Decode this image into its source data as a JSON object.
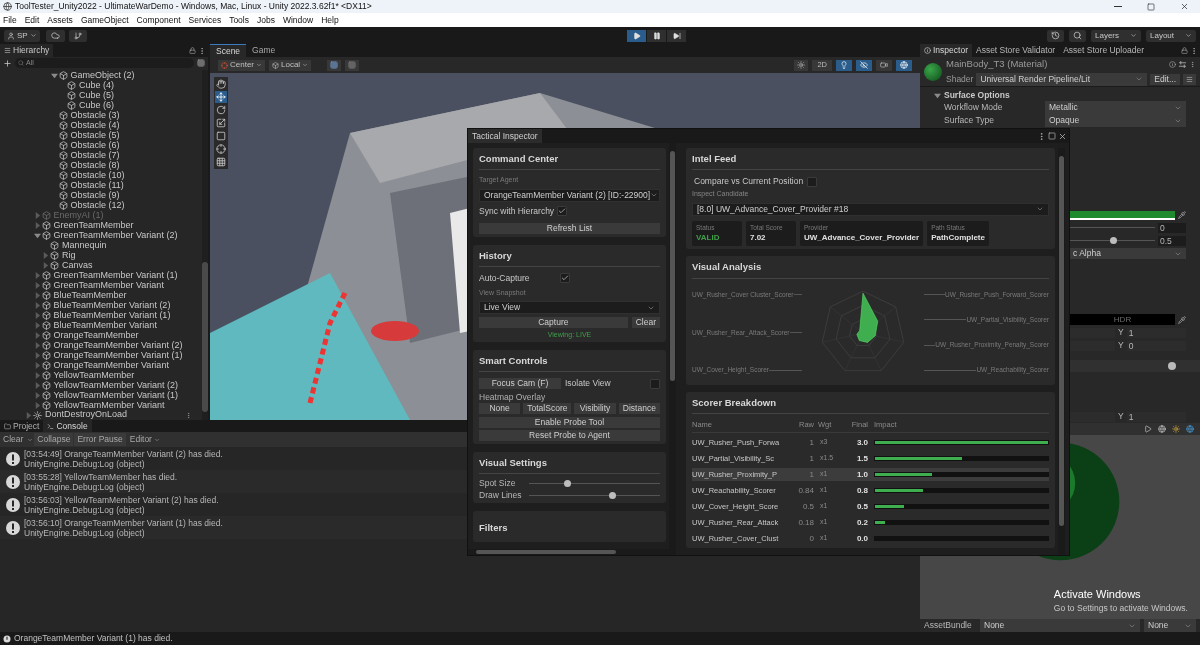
{
  "window": {
    "title": "ToolTester_Unity2022 - UltimateWarDemo - Windows, Mac, Linux - Unity 2022.3.62f1* <DX11>"
  },
  "menu": [
    "File",
    "Edit",
    "Assets",
    "GameObject",
    "Component",
    "Services",
    "Tools",
    "Jobs",
    "Window",
    "Help"
  ],
  "toolbar": {
    "account": "SP",
    "transport": [
      {
        "kind": "play",
        "on": true
      },
      {
        "kind": "pause",
        "on": false
      },
      {
        "kind": "step",
        "on": false
      }
    ],
    "layers": "Layers",
    "layout": "Layout"
  },
  "hierarchy": {
    "title": "Hierarchy",
    "search": {
      "placeholder": "All"
    },
    "clipped_items": [
      {
        "name": "GameObject (2)",
        "kind": "node",
        "expanded": true,
        "inactive": false,
        "children": [
          {
            "name": "Cube (4)",
            "kind": "leaf",
            "inactive": false
          },
          {
            "name": "Cube (5)",
            "kind": "leaf",
            "inactive": false
          },
          {
            "name": "Cube (6)",
            "kind": "leaf",
            "inactive": false
          }
        ]
      },
      {
        "name": "Obstacle (3)",
        "kind": "leaf",
        "inactive": false
      },
      {
        "name": "Obstacle (4)",
        "kind": "leaf",
        "inactive": false
      },
      {
        "name": "Obstacle (5)",
        "kind": "leaf",
        "inactive": false
      },
      {
        "name": "Obstacle (6)",
        "kind": "leaf",
        "inactive": false
      },
      {
        "name": "Obstacle (7)",
        "kind": "leaf",
        "inactive": false
      },
      {
        "name": "Obstacle (8)",
        "kind": "leaf",
        "inactive": false
      },
      {
        "name": "Obstacle (10)",
        "kind": "leaf",
        "inactive": false
      },
      {
        "name": "Obstacle (11)",
        "kind": "leaf",
        "inactive": false
      },
      {
        "name": "Obstacle (9)",
        "kind": "leaf",
        "inactive": false
      },
      {
        "name": "Obstacle (12)",
        "kind": "leaf",
        "inactive": false
      }
    ],
    "items": [
      {
        "name": "EnemyAI (1)",
        "kind": "node",
        "expanded": false,
        "inactive": true
      },
      {
        "name": "GreenTeamMember",
        "kind": "node",
        "expanded": false,
        "inactive": false
      },
      {
        "name": "GreenTeamMember Variant (2)",
        "kind": "node",
        "expanded": true,
        "inactive": false,
        "children": [
          {
            "name": "Mannequin",
            "kind": "leaf",
            "inactive": false
          },
          {
            "name": "Rig",
            "kind": "node",
            "expanded": false,
            "inactive": false
          },
          {
            "name": "Canvas",
            "kind": "node",
            "expanded": false,
            "inactive": false
          }
        ]
      },
      {
        "name": "GreenTeamMember Variant (1)",
        "kind": "node",
        "expanded": false,
        "inactive": false
      },
      {
        "name": "GreenTeamMember Variant",
        "kind": "node",
        "expanded": false,
        "inactive": false
      },
      {
        "name": "BlueTeamMember",
        "kind": "node",
        "expanded": false,
        "inactive": false
      },
      {
        "name": "BlueTeamMember Variant (2)",
        "kind": "node",
        "expanded": false,
        "inactive": false
      },
      {
        "name": "BlueTeamMember Variant (1)",
        "kind": "node",
        "expanded": false,
        "inactive": false
      },
      {
        "name": "BlueTeamMember Variant",
        "kind": "node",
        "expanded": false,
        "inactive": false
      },
      {
        "name": "OrangeTeamMember",
        "kind": "node",
        "expanded": false,
        "inactive": false
      },
      {
        "name": "OrangeTeamMember Variant (2)",
        "kind": "node",
        "expanded": false,
        "inactive": false
      },
      {
        "name": "OrangeTeamMember Variant (1)",
        "kind": "node",
        "expanded": false,
        "inactive": false
      },
      {
        "name": "OrangeTeamMember Variant",
        "kind": "node",
        "expanded": false,
        "inactive": false
      },
      {
        "name": "YellowTeamMember",
        "kind": "node",
        "expanded": false,
        "inactive": false
      },
      {
        "name": "YellowTeamMember Variant (2)",
        "kind": "node",
        "expanded": false,
        "inactive": false
      },
      {
        "name": "YellowTeamMember Variant (1)",
        "kind": "node",
        "expanded": false,
        "inactive": false
      },
      {
        "name": "YellowTeamMember Variant",
        "kind": "node",
        "expanded": false,
        "inactive": false
      }
    ],
    "scene_root": {
      "name": "DontDestroyOnLoad",
      "kind": "node",
      "expanded": false,
      "inactive": false
    }
  },
  "scene": {
    "tabs": [
      {
        "label": "Scene",
        "selected": true
      },
      {
        "label": "Game",
        "selected": false
      }
    ],
    "pivot": "Center",
    "space": "Local",
    "toggle_2d": {
      "label": "2D",
      "on": false
    },
    "lighting_on": true
  },
  "inspector": {
    "tabs": [
      {
        "label": "Inspector",
        "selected": true
      },
      {
        "label": "Asset Store Validator",
        "selected": false
      },
      {
        "label": "Asset Store Uploader",
        "selected": false
      }
    ],
    "material": "MainBody_T3 (Material)",
    "shader_label": "Shader",
    "shader": "Universal Render Pipeline/Lit",
    "edit": "Edit...",
    "section": {
      "label": "Surface Options",
      "expanded": true
    },
    "fields": [
      {
        "label": "Workflow Mode",
        "value": "Metallic"
      },
      {
        "label": "Surface Type",
        "value": "Opaque"
      }
    ],
    "metallic": "0",
    "smoothness": {
      "level": 0.5,
      "reading": "0.5"
    },
    "source": "c Alpha",
    "emission": "HDR",
    "vectors": [
      {
        "axis": "Y",
        "value": "1"
      },
      {
        "axis": "Y",
        "value": "0"
      }
    ],
    "lower_vector": {
      "axis": "Y",
      "value": "1"
    },
    "asset_bundle": {
      "label": "AssetBundle",
      "name": "None",
      "variant": "None"
    }
  },
  "console": {
    "tabs": [
      {
        "label": "Project",
        "selected": false
      },
      {
        "label": "Console",
        "selected": true
      }
    ],
    "buttons": [
      "Clear",
      "Collapse",
      "Error Pause",
      "Editor"
    ],
    "messages": [
      {
        "text": "[03:54:49] OrangeTeamMember Variant (2) has died.",
        "source": "UnityEngine.Debug:Log (object)"
      },
      {
        "text": "[03:55:28] YellowTeamMember has died.",
        "source": "UnityEngine.Debug:Log (object)"
      },
      {
        "text": "[03:56:03] YellowTeamMember Variant (2) has died.",
        "source": "UnityEngine.Debug:Log (object)"
      },
      {
        "text": "[03:56:10] OrangeTeamMember Variant (1) has died.",
        "source": "UnityEngine.Debug:Log (object)"
      }
    ]
  },
  "status_bar": {
    "message": "OrangeTeamMember Variant (1) has died."
  },
  "os_notice": {
    "title": "Activate Windows",
    "text": "Go to Settings to activate Windows."
  },
  "tactical": {
    "title": "Tactical Inspector",
    "command_center": {
      "title": "Command Center",
      "target_label": "Target Agent",
      "target": "OrangeTeamMember Variant (2) [ID:-22900]",
      "sync": {
        "label": "Sync with Hierarchy",
        "checked": true
      },
      "refresh": "Refresh List"
    },
    "history": {
      "title": "History",
      "auto_capture": {
        "label": "Auto-Capture",
        "checked": true
      },
      "snapshot_label": "View Snapshot",
      "snapshot": "Live View",
      "capture": "Capture",
      "clear": "Clear",
      "viewing": "Viewing: LIVE"
    },
    "smart_controls": {
      "title": "Smart Controls",
      "focus": "Focus Cam (F)",
      "isolate": {
        "label": "Isolate View",
        "checked": false
      },
      "heatmap_label": "Heatmap Overlay",
      "heatmap": [
        "None",
        "TotalScore",
        "Visibility",
        "Distance"
      ],
      "probe": "Enable Probe Tool",
      "reset": "Reset Probe to Agent"
    },
    "visual_settings": {
      "title": "Visual Settings",
      "sliders": [
        {
          "label": "Spot Size",
          "level": 0.29
        },
        {
          "label": "Draw Lines",
          "level": 0.63
        }
      ]
    },
    "filters": {
      "title": "Filters"
    },
    "intel": {
      "title": "Intel Feed",
      "compare": {
        "label": "Compare vs Current Position",
        "checked": false
      },
      "candidate_label": "Inspect Candidate",
      "candidate": "[8.0] UW_Advance_Cover_Provider #18",
      "cards": [
        {
          "label": "Status",
          "value": "VALID",
          "kind": "ok"
        },
        {
          "label": "Total Score",
          "value": "7.02",
          "kind": "plain"
        },
        {
          "label": "Provider",
          "value": "UW_Advance_Cover_Provider",
          "kind": "plain"
        },
        {
          "label": "Path Status",
          "value": "PathComplete",
          "kind": "plain"
        }
      ]
    },
    "analysis": {
      "title": "Visual Analysis",
      "left_axes": [
        "UW_Rusher_Cover Cluster_Scorer",
        "UW_Rusher_Rear_Attack_Scorer",
        "UW_Cover_Height_Scorer"
      ],
      "right_axes": [
        "UW_Rusher_Push_Forward_Scorer",
        "UW_Partial_Visibility_Scorer",
        "UW_Rusher_Proximity_Penalty_Scorer",
        "UW_Reachability_Scorer"
      ]
    },
    "breakdown": {
      "title": "Scorer Breakdown",
      "columns": [
        "Name",
        "Raw",
        "Wgt",
        "Final",
        "Impact"
      ],
      "rows": [
        {
          "name": "UW_Rusher_Push_Forwa",
          "raw": "1",
          "wgt": "x3",
          "final": "3.0",
          "level": 1.0,
          "selected": false
        },
        {
          "name": "UW_Partial_Visibility_Sc",
          "raw": "1",
          "wgt": "x1.5",
          "final": "1.5",
          "level": 0.5,
          "selected": false
        },
        {
          "name": "UW_Rusher_Proximity_P",
          "raw": "1",
          "wgt": "x1",
          "final": "1.0",
          "level": 0.33,
          "selected": true
        },
        {
          "name": "UW_Reachability_Scorer",
          "raw": "0.84",
          "wgt": "x1",
          "final": "0.8",
          "level": 0.28,
          "selected": false
        },
        {
          "name": "UW_Cover_Height_Score",
          "raw": "0.5",
          "wgt": "x1",
          "final": "0.5",
          "level": 0.17,
          "selected": false
        },
        {
          "name": "UW_Rusher_Rear_Attack",
          "raw": "0.18",
          "wgt": "x1",
          "final": "0.2",
          "level": 0.06,
          "selected": false
        },
        {
          "name": "UW_Rusher_Cover_Clust",
          "raw": "0",
          "wgt": "x1",
          "final": "0.0",
          "selected": false
        }
      ]
    }
  }
}
